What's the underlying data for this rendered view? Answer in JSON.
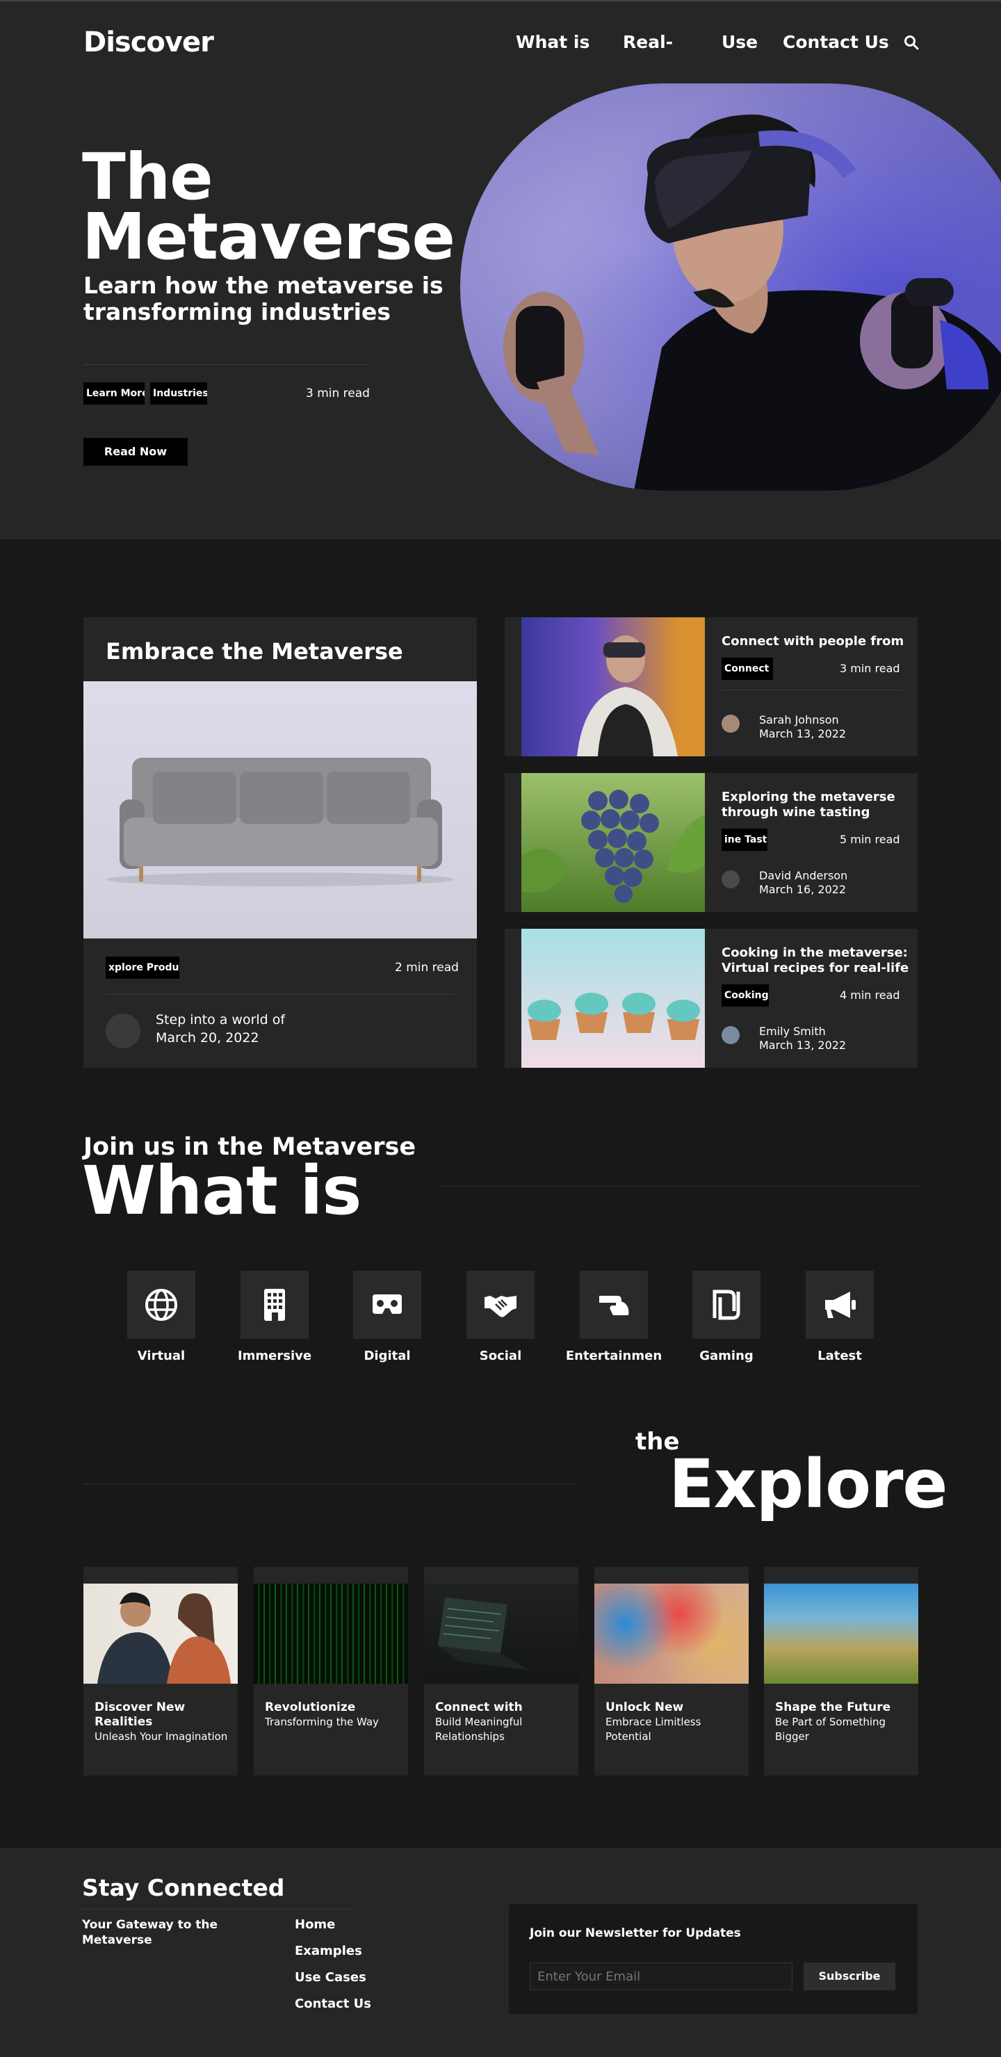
{
  "header": {
    "logo": "Discover",
    "nav": [
      "What is",
      "Real-",
      "Use",
      "Contact Us"
    ]
  },
  "hero": {
    "title_line1": "The",
    "title_line2": "Metaverse",
    "subtitle": "Learn how the metaverse is transforming industries",
    "tags": [
      "Learn More",
      "Industries"
    ],
    "read_time": "3 min read",
    "cta": "Read Now"
  },
  "featured": {
    "main": {
      "title": "Embrace the Metaverse",
      "tag": "xplore Product",
      "read_time": "2 min read",
      "excerpt": "Step into a world of",
      "date": "March 20, 2022"
    },
    "side": [
      {
        "title": "Connect with people from",
        "tag": "Connect",
        "read_time": "3 min read",
        "author": "Sarah Johnson",
        "date": "March 13, 2022"
      },
      {
        "title": "Exploring the metaverse through wine tasting",
        "tag": "ine Tastir",
        "read_time": "5 min read",
        "author": "David Anderson",
        "date": "March 16, 2022"
      },
      {
        "title": "Cooking in the metaverse: Virtual recipes for real-life",
        "tag": "Cooking",
        "read_time": "4 min read",
        "author": "Emily Smith",
        "date": "March 13, 2022"
      }
    ]
  },
  "whatis": {
    "kicker": "Join us in the Metaverse",
    "title": "What is",
    "items": [
      {
        "label": "Virtual",
        "icon": "globe-icon"
      },
      {
        "label": "Immersive",
        "icon": "building-icon"
      },
      {
        "label": "Digital",
        "icon": "vr-headset-icon"
      },
      {
        "label": "Social",
        "icon": "handshake-icon"
      },
      {
        "label": "Entertainmen",
        "icon": "hand-icon"
      },
      {
        "label": "Gaming",
        "icon": "shekel-icon"
      },
      {
        "label": "Latest",
        "icon": "megaphone-icon"
      }
    ]
  },
  "explore": {
    "kicker": "the",
    "title": "Explore",
    "cards": [
      {
        "title": "Discover New Realities",
        "subtitle": "Unleash Your Imagination"
      },
      {
        "title": "Revolutionize",
        "subtitle": "Transforming the Way"
      },
      {
        "title": "Connect with",
        "subtitle": "Build Meaningful Relationships"
      },
      {
        "title": "Unlock New",
        "subtitle": "Embrace Limitless Potential"
      },
      {
        "title": "Shape the Future",
        "subtitle": "Be Part of Something Bigger"
      }
    ]
  },
  "footer": {
    "title": "Stay Connected",
    "tagline": "Your Gateway to the Metaverse",
    "links": [
      "Home",
      "Examples",
      "Use Cases",
      "Contact Us"
    ],
    "newsletter_title": "Join our Newsletter for Updates",
    "email_placeholder": "Enter Your Email",
    "subscribe": "Subscribe"
  },
  "colors": {
    "background": "#181818",
    "panel": "#262626",
    "tag": "#000000",
    "text": "#ffffff"
  }
}
